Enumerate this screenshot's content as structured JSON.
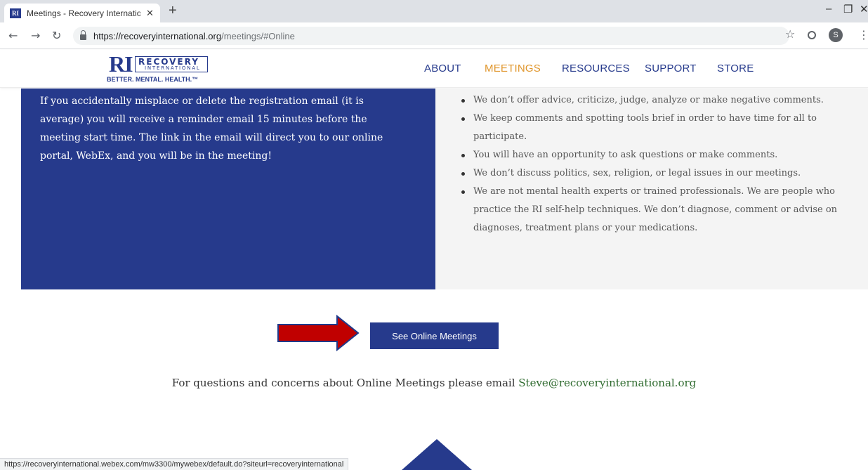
{
  "browser": {
    "tab_title": "Meetings - Recovery Internationa",
    "tab_favicon": "RI",
    "tab_close": "✕",
    "new_tab": "+",
    "url_host": "https://recoveryinternational.org",
    "url_path": "/meetings/#Online",
    "profile_initial": "S",
    "status_url": "https://recoveryinternational.webex.com/mw3300/mywebex/default.do?siteurl=recoveryinternational"
  },
  "logo": {
    "mark": "RI",
    "word": "RECOVERY",
    "sub": "INTERNATIONAL",
    "tagline": "BETTER. MENTAL. HEALTH.™"
  },
  "nav": [
    {
      "label": "ABOUT",
      "active": false
    },
    {
      "label": "MEETINGS",
      "active": true
    },
    {
      "label": "RESOURCES",
      "active": false
    },
    {
      "label": "SUPPORT",
      "active": false
    },
    {
      "label": "STORE",
      "active": false
    }
  ],
  "left_panel": {
    "text": "If you accidentally misplace or delete the registration email (it is average) you will receive a reminder email 15 minutes before the meeting start time. The link in the email will direct you to our online portal, WebEx, and you will be in the meeting!"
  },
  "rules": [
    "We don’t offer advice, criticize, judge, analyze or make negative comments.",
    "We keep comments and spotting tools brief in order to have time for all to participate.",
    "You will have an opportunity to ask questions or make comments.",
    "We don’t discuss politics, sex, religion, or legal issues in our meetings.",
    "We are not mental health experts or trained professionals. We are people who practice the RI self-help techniques. We don’t diagnose, comment or advise on diagnoses, treatment plans or your medications."
  ],
  "cta": {
    "label": "See Online Meetings"
  },
  "contact": {
    "text": "For questions and concerns about Online Meetings please email ",
    "email": "Steve@recoveryinternational.org"
  },
  "colors": {
    "brand_blue": "#263a8c",
    "active_nav": "#e0962c",
    "email_green": "#2f6b2f",
    "arrow_red": "#c00000"
  }
}
